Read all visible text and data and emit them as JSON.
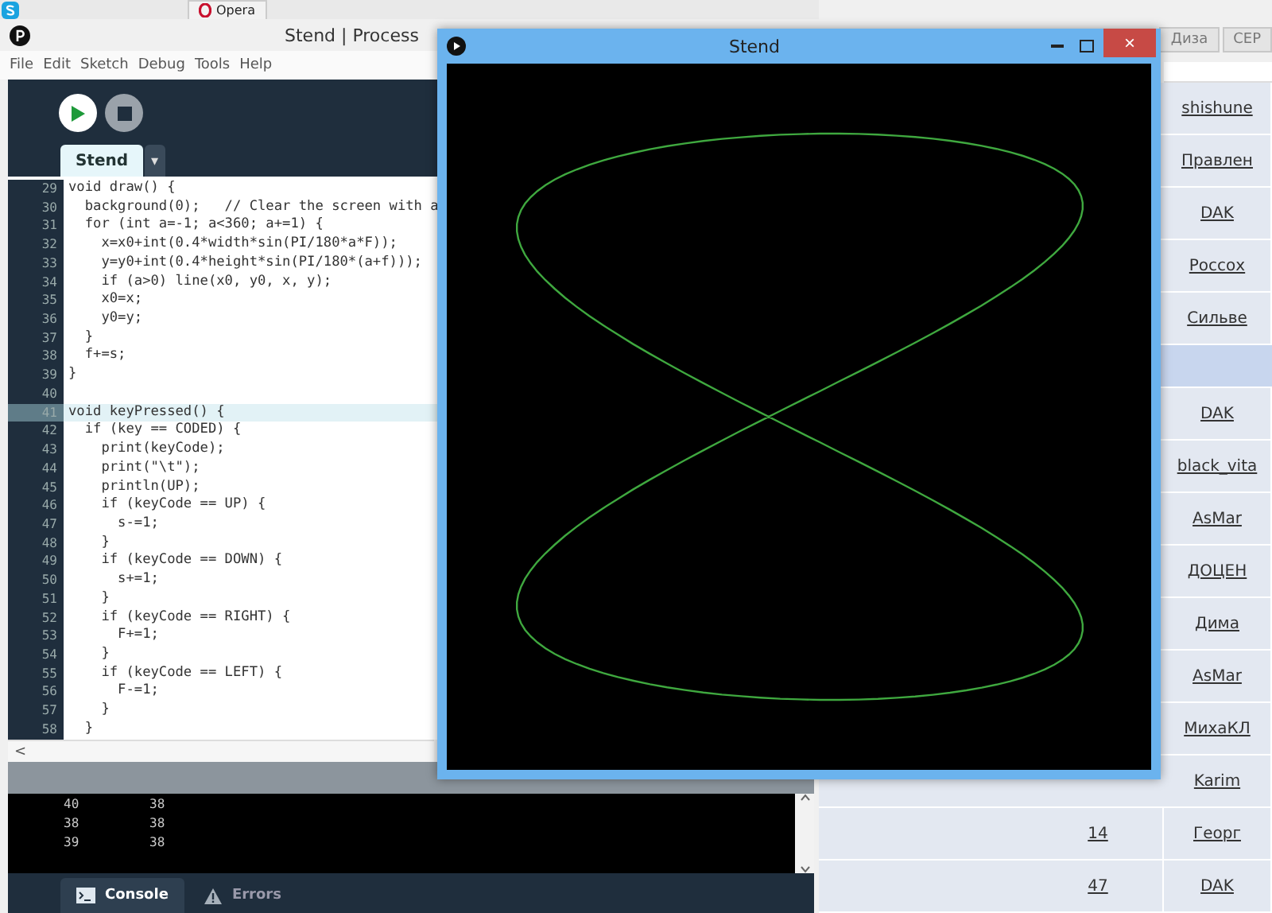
{
  "taskbar": {
    "items": [
      {
        "kind": "app-icon"
      },
      {
        "kind": "tab",
        "label": "Opera"
      }
    ]
  },
  "browser": {
    "tabs": [
      {
        "label": "Диза"
      },
      {
        "label": "CEP"
      }
    ],
    "rows": [
      {
        "num": "",
        "name": "shishune",
        "highlighted": false
      },
      {
        "num": "",
        "name": "Правлен",
        "highlighted": false
      },
      {
        "num": "",
        "name": "DAK",
        "highlighted": false
      },
      {
        "num": "",
        "name": "Россох",
        "highlighted": false
      },
      {
        "num": "",
        "name": "Сильве",
        "highlighted": false
      },
      {
        "num": "",
        "name": "",
        "highlighted": true
      },
      {
        "num": "",
        "name": "DAK",
        "highlighted": false
      },
      {
        "num": "",
        "name": "black_vita",
        "highlighted": false
      },
      {
        "num": "",
        "name": "AsMar",
        "highlighted": false
      },
      {
        "num": "",
        "name": "ДОЦЕН",
        "highlighted": false
      },
      {
        "num": "",
        "name": "Дима",
        "highlighted": false
      },
      {
        "num": "",
        "name": "AsMar",
        "highlighted": false
      },
      {
        "num": "",
        "name": "МихаКЛ",
        "highlighted": false
      },
      {
        "num": "",
        "name": "Karim",
        "highlighted": false
      },
      {
        "num": "14",
        "name": "Георг",
        "highlighted": false
      },
      {
        "num": "47",
        "name": "DAK",
        "highlighted": false
      }
    ]
  },
  "ide": {
    "title": "Stend | Process",
    "menu": [
      "File",
      "Edit",
      "Sketch",
      "Debug",
      "Tools",
      "Help"
    ],
    "tab": {
      "label": "Stend",
      "dropdown": "▾"
    },
    "code": [
      {
        "n": "29",
        "text": "void draw() {",
        "current": false
      },
      {
        "n": "30",
        "text": "  background(0);   // Clear the screen with a",
        "current": false
      },
      {
        "n": "31",
        "text": "  for (int a=-1; a<360; a+=1) {",
        "current": false
      },
      {
        "n": "32",
        "text": "    x=x0+int(0.4*width*sin(PI/180*a*F));",
        "current": false
      },
      {
        "n": "33",
        "text": "    y=y0+int(0.4*height*sin(PI/180*(a+f)));",
        "current": false
      },
      {
        "n": "34",
        "text": "    if (a>0) line(x0, y0, x, y);",
        "current": false
      },
      {
        "n": "35",
        "text": "    x0=x;",
        "current": false
      },
      {
        "n": "36",
        "text": "    y0=y;",
        "current": false
      },
      {
        "n": "37",
        "text": "  }",
        "current": false
      },
      {
        "n": "38",
        "text": "  f+=s;",
        "current": false
      },
      {
        "n": "39",
        "text": "}",
        "current": false
      },
      {
        "n": "40",
        "current": false
      },
      {
        "n": "41",
        "text": "void keyPressed() {",
        "current": true
      },
      {
        "n": "42",
        "text": "  if (key == CODED) {",
        "current": false
      },
      {
        "n": "43",
        "text": "    print(keyCode);",
        "current": false
      },
      {
        "n": "44",
        "text": "    print(\"\\t\");",
        "current": false
      },
      {
        "n": "45",
        "text": "    println(UP);",
        "current": false
      },
      {
        "n": "46",
        "text": "    if (keyCode == UP) {",
        "current": false
      },
      {
        "n": "47",
        "text": "      s-=1;",
        "current": false
      },
      {
        "n": "48",
        "text": "    }",
        "current": false
      },
      {
        "n": "49",
        "text": "    if (keyCode == DOWN) {",
        "current": false
      },
      {
        "n": "50",
        "text": "      s+=1;",
        "current": false
      },
      {
        "n": "51",
        "text": "    }",
        "current": false
      },
      {
        "n": "52",
        "text": "    if (keyCode == RIGHT) {",
        "current": false
      },
      {
        "n": "53",
        "text": "      F+=1;",
        "current": false
      },
      {
        "n": "54",
        "text": "    }",
        "current": false
      },
      {
        "n": "55",
        "text": "    if (keyCode == LEFT) {",
        "current": false
      },
      {
        "n": "56",
        "text": "      F-=1;",
        "current": false
      },
      {
        "n": "57",
        "text": "    }",
        "current": false
      },
      {
        "n": "58",
        "text": "  }",
        "current": false
      }
    ],
    "hscroll": "<",
    "console": [
      [
        "40",
        "38"
      ],
      [
        "38",
        "38"
      ],
      [
        "39",
        "38"
      ]
    ],
    "console_tabs": [
      {
        "label": "Console",
        "kind": "console",
        "selected": true
      },
      {
        "label": "Errors",
        "kind": "errors",
        "selected": false
      }
    ]
  },
  "sketch": {
    "title": "Stend",
    "close": "×"
  }
}
